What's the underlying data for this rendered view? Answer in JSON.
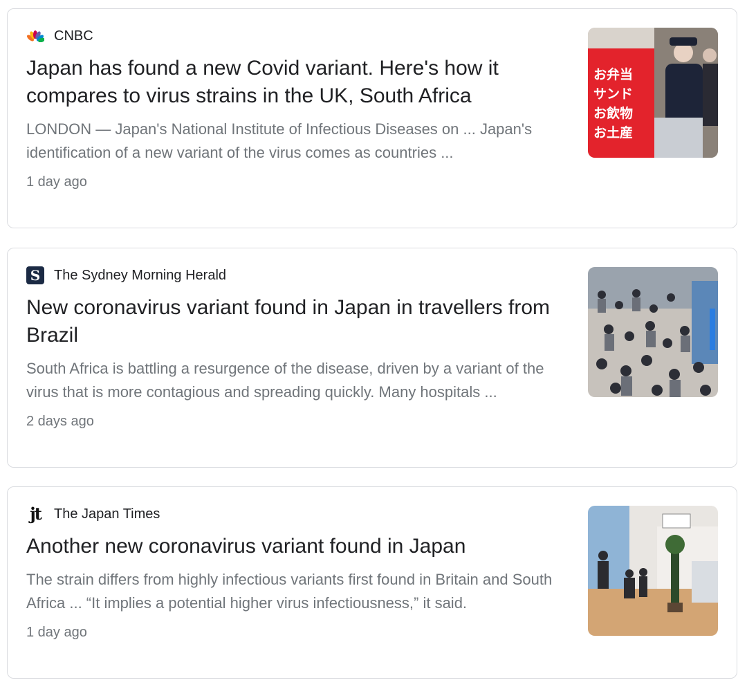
{
  "articles": [
    {
      "source": "CNBC",
      "source_icon": "cnbc-peacock-icon",
      "headline": "Japan has found a new Covid variant. Here's how it compares to virus strains in the UK, South Africa",
      "snippet": "LONDON — Japan's National Institute of Infectious Diseases on ... Japan's identification of a new variant of the virus comes as countries ...",
      "age": "1 day ago",
      "thumbnail": "photo of masked staff beside red station kiosk sign",
      "sign_text": [
        "お弁当",
        "サンド",
        "お飲物",
        "お土産"
      ]
    },
    {
      "source": "The Sydney Morning Herald",
      "source_icon": "smh-s-icon",
      "logo_letter": "S",
      "headline": "New coronavirus variant found in Japan in travellers from Brazil",
      "snippet": "South Africa is battling a resurgence of the disease, driven by a variant of the virus that is more contagious and spreading quickly. Many hospitals ...",
      "age": "2 days ago",
      "thumbnail": "photo of crowded airport terminal"
    },
    {
      "source": "The Japan Times",
      "source_icon": "jt-icon",
      "logo_letter": "jt",
      "headline": "Another new coronavirus variant found in Japan",
      "snippet": "The strain differs from highly infectious variants first found in Britain and South Africa ... “It implies a potential higher virus infectiousness,” it said.",
      "age": "1 day ago",
      "thumbnail": "photo of travellers in bright airport hall"
    }
  ],
  "colors": {
    "headline": "#202124",
    "secondary": "#70757a",
    "border": "#dadce0",
    "kiosk_red": "#e3232c",
    "smh_navy": "#1b2a44"
  }
}
